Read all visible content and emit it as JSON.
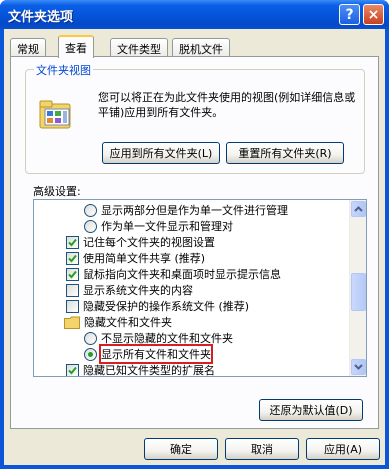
{
  "window": {
    "title": "文件夹选项",
    "help_label": "?",
    "close_label": "×"
  },
  "tabs": [
    {
      "label": "常规"
    },
    {
      "label": "查看"
    },
    {
      "label": "文件类型"
    },
    {
      "label": "脱机文件"
    }
  ],
  "folder_views": {
    "legend": "文件夹视图",
    "description": "您可以将正在为此文件夹使用的视图(例如详细信息或平铺)应用到所有文件夹。",
    "apply_all_label": "应用到所有文件夹(L)",
    "reset_all_label": "重置所有文件夹(R)"
  },
  "advanced": {
    "label": "高级设置:",
    "items": [
      {
        "type": "radio",
        "checked": false,
        "label": "显示两部分但是作为单一文件进行管理"
      },
      {
        "type": "radio",
        "checked": false,
        "label": "作为单一文件显示和管理对"
      },
      {
        "type": "checkbox",
        "checked": true,
        "label": "记住每个文件夹的视图设置"
      },
      {
        "type": "checkbox",
        "checked": true,
        "label": "使用简单文件共享 (推荐)"
      },
      {
        "type": "checkbox",
        "checked": true,
        "label": "鼠标指向文件夹和桌面项时显示提示信息"
      },
      {
        "type": "checkbox",
        "checked": false,
        "label": "显示系统文件夹的内容"
      },
      {
        "type": "checkbox",
        "checked": false,
        "label": "隐藏受保护的操作系统文件 (推荐)"
      },
      {
        "type": "folder",
        "label": "隐藏文件和文件夹"
      },
      {
        "type": "radio",
        "checked": false,
        "label": "不显示隐藏的文件和文件夹"
      },
      {
        "type": "radio",
        "checked": true,
        "label": "显示所有文件和文件夹",
        "highlighted": true
      },
      {
        "type": "checkbox",
        "checked": true,
        "label": "隐藏已知文件类型的扩展名"
      }
    ]
  },
  "restore_defaults_label": "还原为默认值(D)",
  "footer": {
    "ok_label": "确定",
    "cancel_label": "取消",
    "apply_label": "应用(A)"
  },
  "colors": {
    "titlebar": "#0453d8",
    "dialog_bg": "#ece9d8",
    "highlight_box": "#d42020",
    "check_green": "#21a121"
  }
}
